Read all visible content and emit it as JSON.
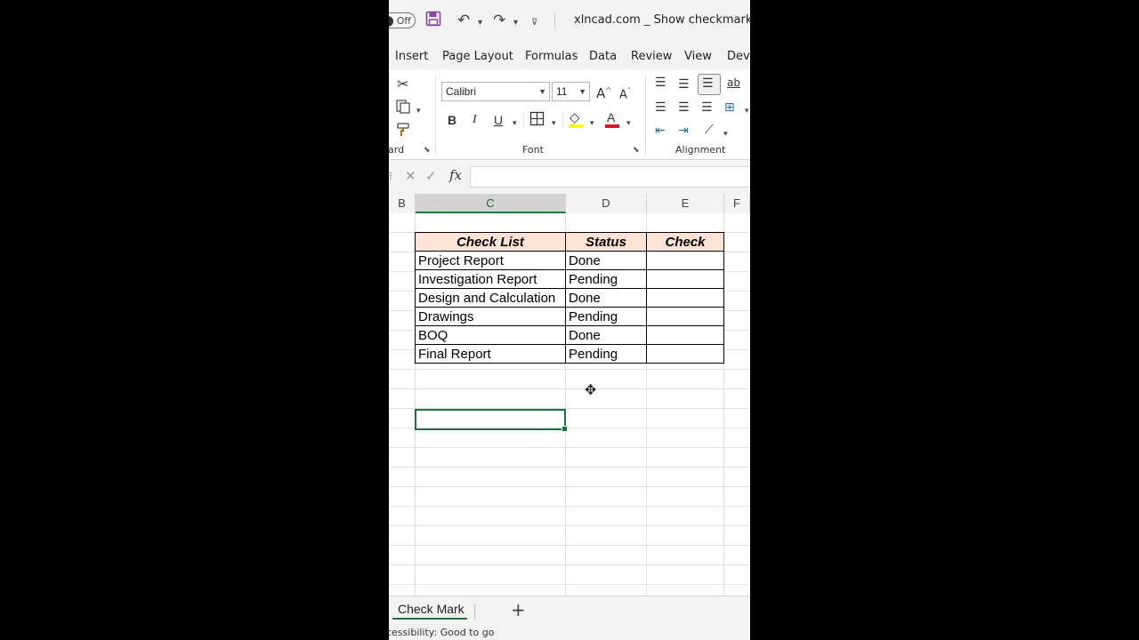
{
  "titlebar": {
    "autosave_state": "Off",
    "doc_title": "xlncad.com _ Show checkmark if com"
  },
  "ribbon_tabs": [
    "Insert",
    "Page Layout",
    "Formulas",
    "Data",
    "Review",
    "View",
    "Deve"
  ],
  "ribbon": {
    "clipboard_label": "ard",
    "font_group_label": "Font",
    "alignment_group_label": "Alignment",
    "font_name": "Calibri",
    "font_size": "11",
    "bold": "B",
    "italic": "I",
    "underline": "U",
    "grow_font": "A",
    "shrink_font": "A",
    "font_color_glyph": "A",
    "wrap_glyph": "ab",
    "fill_color": "#ffff00",
    "font_color": "#e81123"
  },
  "formula_bar": {
    "fx": "fx",
    "value": ""
  },
  "columns": [
    {
      "label": "B"
    },
    {
      "label": "C"
    },
    {
      "label": "D"
    },
    {
      "label": "E"
    },
    {
      "label": "F"
    }
  ],
  "table": {
    "headers": [
      "Check List",
      "Status",
      "Check"
    ],
    "rows": [
      [
        "Project Report",
        "Done",
        ""
      ],
      [
        "Investigation Report",
        "Pending",
        ""
      ],
      [
        "Design and Calculation",
        "Done",
        ""
      ],
      [
        "Drawings",
        "Pending",
        ""
      ],
      [
        "BOQ",
        "Done",
        ""
      ],
      [
        "Final Report",
        "Pending",
        ""
      ]
    ]
  },
  "sheet": {
    "tab_label": "Check Mark",
    "add_label": "+"
  },
  "status": {
    "text": "cessibility: Good to go"
  }
}
